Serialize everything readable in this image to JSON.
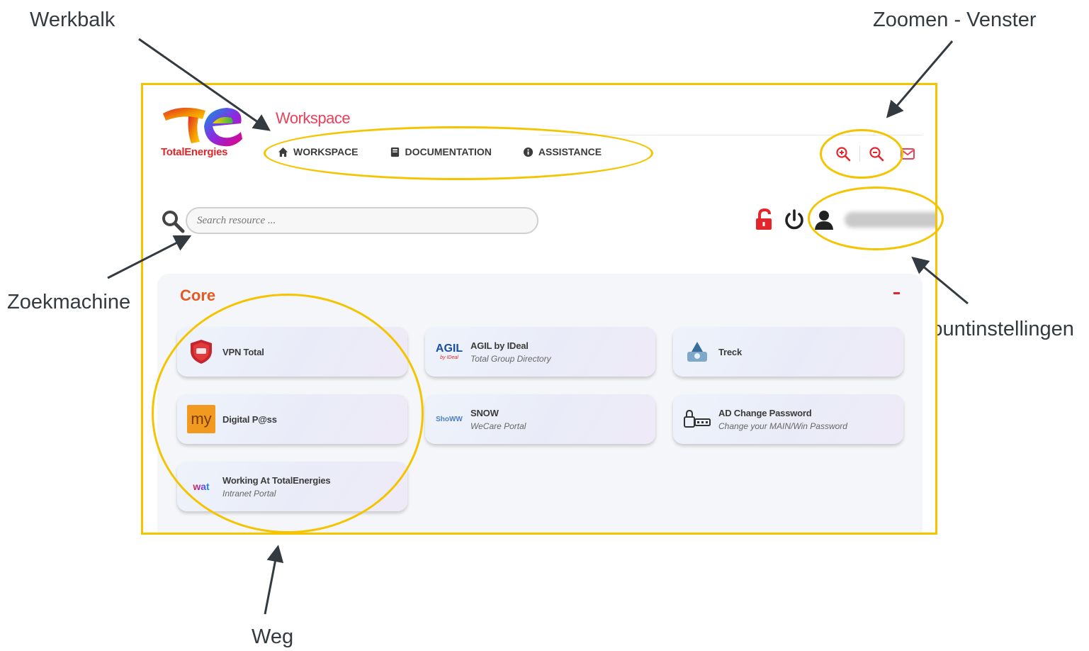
{
  "callouts": {
    "werkbalk": "Werkbalk",
    "zoom": "Zoomen - Venster",
    "zoekmachine": "Zoekmachine",
    "account": "Accountinstellingen",
    "weg": "Weg"
  },
  "brand": {
    "name": "TotalEnergies",
    "app_title": "Workspace",
    "accent": "#e8425a",
    "highlight": "#f5c400"
  },
  "nav": [
    {
      "label": "WORKSPACE",
      "icon": "home-icon"
    },
    {
      "label": "DOCUMENTATION",
      "icon": "book-icon"
    },
    {
      "label": "ASSISTANCE",
      "icon": "info-icon"
    }
  ],
  "tools": [
    {
      "name": "zoom-in-icon"
    },
    {
      "name": "zoom-out-icon"
    },
    {
      "name": "mail-icon"
    }
  ],
  "search": {
    "placeholder": "Search resource ..."
  },
  "section": {
    "title": "Core",
    "cards": [
      {
        "title": "VPN Total",
        "subtitle": "",
        "logo": "vpn-shield"
      },
      {
        "title": "AGIL by IDeal",
        "subtitle": "Total Group Directory",
        "logo": "agil"
      },
      {
        "title": "Treck",
        "subtitle": "",
        "logo": "treck"
      },
      {
        "title": "Digital P@ss",
        "subtitle": "",
        "logo": "my"
      },
      {
        "title": "SNOW",
        "subtitle": "WeCare Portal",
        "logo": "snow"
      },
      {
        "title": "AD Change Password",
        "subtitle": "Change your MAIN/Win Password",
        "logo": "ad-lock"
      },
      {
        "title": "Working At TotalEnergies",
        "subtitle": "Intranet Portal",
        "logo": "wat"
      }
    ]
  },
  "logos": {
    "agil_main": "AGIL",
    "agil_sub": "by IDeal",
    "my": "my",
    "snow": "ShoWW",
    "wat": "wat"
  }
}
